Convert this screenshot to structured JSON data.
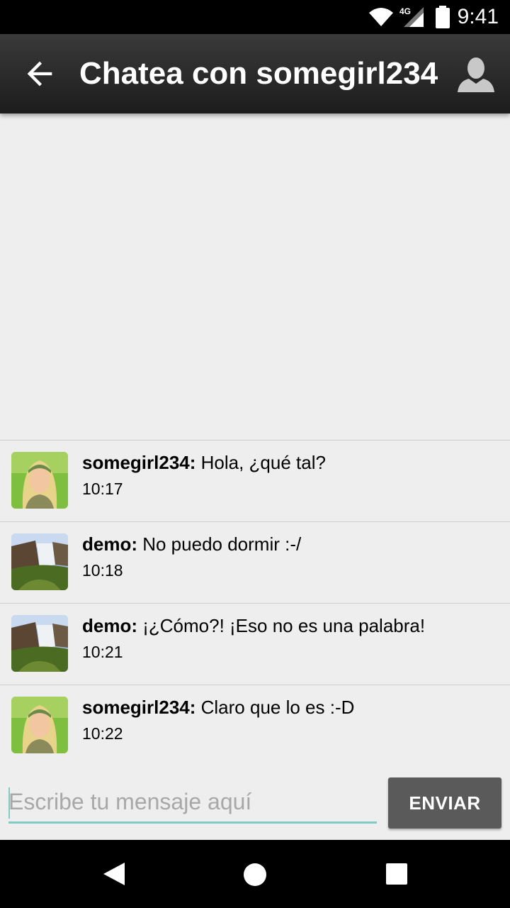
{
  "status_bar": {
    "time": "9:41",
    "network": "4G"
  },
  "app_bar": {
    "title": "Chatea con somegirl234",
    "back_icon": "arrow-back-icon",
    "profile_icon": "person-icon"
  },
  "messages": [
    {
      "sender": "somegirl234:",
      "text": " Hola, ¿qué tal?",
      "time": "10:17",
      "avatar": "woman"
    },
    {
      "sender": "demo:",
      "text": " No puedo dormir :-/",
      "time": "10:18",
      "avatar": "waterfall"
    },
    {
      "sender": "demo:",
      "text": " ¡¿Cómo?! ¡Eso no es una palabra!",
      "time": "10:21",
      "avatar": "waterfall"
    },
    {
      "sender": "somegirl234:",
      "text": " Claro que lo es :-D",
      "time": "10:22",
      "avatar": "woman"
    }
  ],
  "composer": {
    "placeholder": "Escribe tu mensaje aquí",
    "value": "",
    "send_label": "ENVIAR"
  },
  "colors": {
    "accent": "#80cbc4",
    "app_bar": "#2a2a2a",
    "send_button": "#5a5a5a",
    "background": "#eeeeee"
  }
}
